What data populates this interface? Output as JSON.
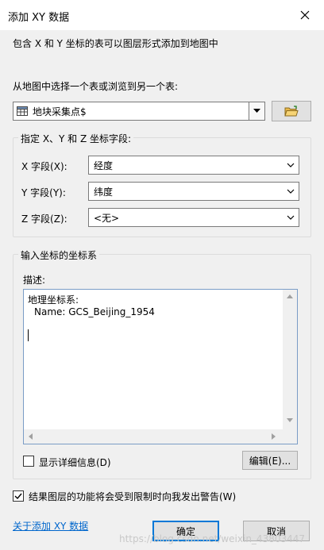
{
  "window": {
    "title": "添加 XY 数据",
    "close_icon": "close-icon"
  },
  "description_top": "包含 X 和 Y 坐标的表可以图层形式添加到地图中",
  "table_select": {
    "label": "从地图中选择一个表或浏览到另一个表:",
    "value": "地块采集点$"
  },
  "fields_group": {
    "legend": "指定 X、Y 和 Z 坐标字段:",
    "x_label": "X 字段(X):",
    "x_value": "经度",
    "y_label": "Y 字段(Y):",
    "y_value": "纬度",
    "z_label": "Z 字段(Z):",
    "z_value": "<无>"
  },
  "coord_group": {
    "legend": "输入坐标的坐标系",
    "desc_label": "描述:",
    "desc_line1": "地理坐标系:",
    "desc_line2": "Name: GCS_Beijing_1954",
    "show_details_label": "显示详细信息(D)",
    "show_details_checked": false,
    "edit_button": "编辑(E)..."
  },
  "warning": {
    "label": "结果图层的功能将会受到限制时向我发出警告(W)",
    "checked": true
  },
  "footer": {
    "about_link": "关于添加 XY 数据",
    "ok_button": "确定",
    "cancel_button": "取消"
  },
  "watermark": "https://blog.csdn.net/weixin_43803447",
  "colors": {
    "dialog_bg": "#f0f0f0",
    "accent": "#0078d7",
    "link": "#0066cc"
  }
}
